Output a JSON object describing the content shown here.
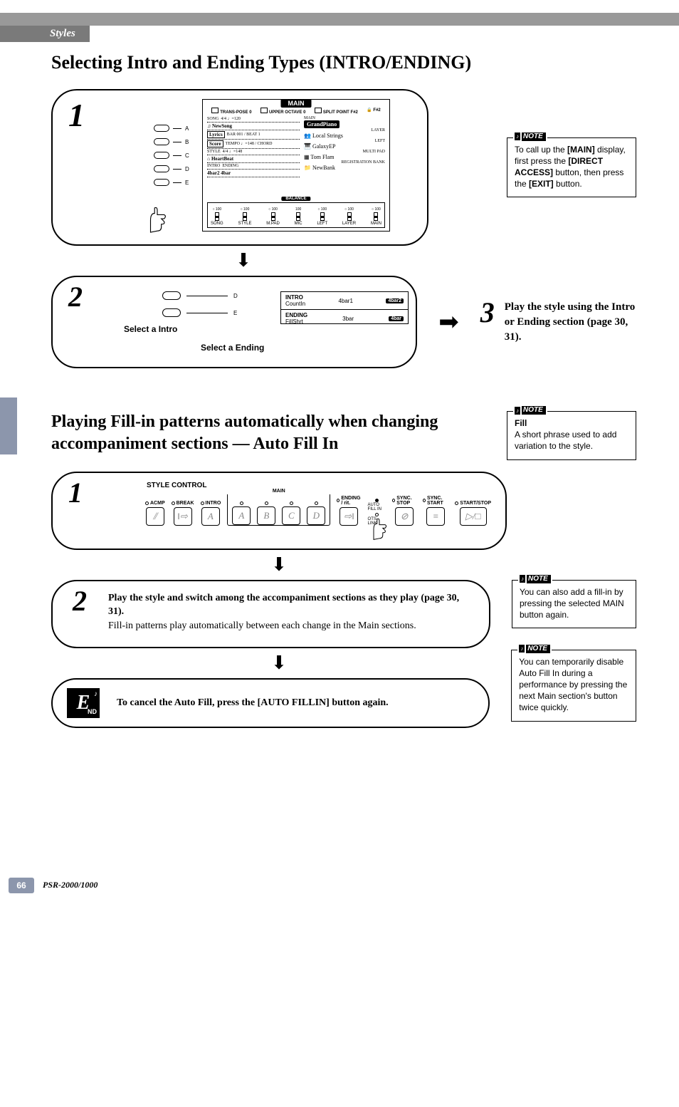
{
  "header": {
    "section": "Styles"
  },
  "title1": "Selecting Intro and Ending Types (INTRO/ENDING)",
  "note1": {
    "badge": "♪ NOTE",
    "text_parts": [
      "To call up the ",
      "[MAIN]",
      " display, first press the ",
      "[DIRECT ACCESS]",
      " button, then press the ",
      "[EXIT]",
      " button."
    ]
  },
  "step1": {
    "num": "1",
    "lcd": {
      "title": "MAIN",
      "top": [
        {
          "label": "TRANS-POSE",
          "val": "0"
        },
        {
          "label": "UPPER OCTAVE",
          "val": "0"
        },
        {
          "label": "SPLIT POINT",
          "val": "F#2"
        },
        {
          "label": "",
          "val": "F#2"
        }
      ],
      "rowsLeft": [
        {
          "tag": "SONG",
          "meta": "4/4  ♩=120",
          "value": "♫ NewSong"
        },
        {
          "tag": "Lyrics",
          "meta": "BAR 001 / BEAT 1",
          "value": ""
        },
        {
          "tag": "Score",
          "meta": "TEMPO ♩=148 / CHORD",
          "value": ""
        },
        {
          "tag": "STYLE",
          "meta": "4/4  ♩=148",
          "value": "⌂ HeartBeat"
        },
        {
          "tag": "INTRO",
          "meta": "ENDING",
          "value": "4bar2   4bar"
        }
      ],
      "rowsRight": [
        {
          "label": "MAIN",
          "value": "GrandPiano",
          "black": true
        },
        {
          "label": "LAYER",
          "value": "Local Strings"
        },
        {
          "label": "LEFT",
          "value": "GalaxyEP"
        },
        {
          "label": "MULTI PAD",
          "value": "Tom Flam"
        },
        {
          "label": "REGISTRATION BANK",
          "value": "NewBank"
        }
      ],
      "balance": {
        "title": "BALANCE",
        "faders": [
          {
            "name": "SONG",
            "val": "○ 100"
          },
          {
            "name": "STYLE",
            "val": "○ 100"
          },
          {
            "name": "M.PAD",
            "val": "○ 100"
          },
          {
            "name": "MIC",
            "val": "100"
          },
          {
            "name": "LEFT",
            "val": "○ 100"
          },
          {
            "name": "LAYER",
            "val": "○ 100"
          },
          {
            "name": "MAIN",
            "val": "○ 100"
          }
        ]
      }
    },
    "hwLetters": [
      "A",
      "B",
      "C",
      "D",
      "E"
    ]
  },
  "step2": {
    "num": "2",
    "captionIntro": "Select a Intro",
    "captionEnding": "Select a Ending",
    "sublcd": {
      "row1": {
        "left": "INTRO",
        "sub": "CountIn",
        "mid": "4bar1",
        "pill": "4bar2"
      },
      "row2": {
        "left": "ENDING",
        "sub": "FillShrt",
        "mid": "3bar",
        "pill": "4bar"
      }
    },
    "hwLetters": [
      "D",
      "E"
    ]
  },
  "step3": {
    "num": "3",
    "text": "Play the style using the Intro or Ending section (page 30, 31)."
  },
  "title2": "Playing Fill-in patterns automatically when changing accompaniment sections — Auto Fill In",
  "note2": {
    "badge": "♪ NOTE",
    "heading": "Fill",
    "body": "A short phrase used to add variation to the style."
  },
  "sc": {
    "num": "1",
    "title": "STYLE CONTROL",
    "buttons": {
      "acmp": "ACMP",
      "break": "BREAK",
      "intro": "INTRO",
      "mainGroup": "MAIN",
      "main": [
        "A",
        "B",
        "C",
        "D"
      ],
      "ending": "ENDING / rit.",
      "auto_fill": "AUTO FILL IN",
      "ots_link": "OTS LINK",
      "sync_stop": "SYNC. STOP",
      "sync_start": "SYNC. START",
      "start_stop": "START/STOP"
    }
  },
  "stepD": {
    "num": "2",
    "bold": "Play the style and switch among the accompaniment sections as they play (page 30, 31).",
    "body": "Fill-in patterns play automatically between each change in the Main sections."
  },
  "note3": {
    "badge": "♪ NOTE",
    "body": "You can also add a fill-in by pressing the selected MAIN button again."
  },
  "note4": {
    "badge": "♪ NOTE",
    "body": "You can temporarily disable Auto Fill In during a performance by pressing the next Main section's button twice quickly."
  },
  "end": {
    "label_e": "E",
    "label_nd": "ND",
    "text": "To cancel the Auto Fill, press the [AUTO FILLIN] button again."
  },
  "footer": {
    "page": "66",
    "model": "PSR-2000/1000"
  }
}
